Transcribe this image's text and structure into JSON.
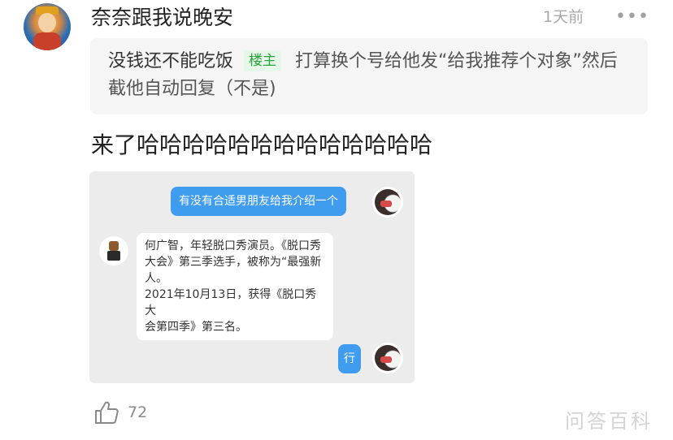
{
  "comment": {
    "username": "奈奈跟我说晚安",
    "time": "1天前",
    "more_glyph": "•••",
    "quote": {
      "author": "没钱还不能吃饭",
      "badge": "楼主",
      "text": "打算换个号给他发“给我推荐个对象”然后截他自动回复（不是)"
    },
    "reply_text": "来了哈哈哈哈哈哈哈哈哈哈哈哈哈",
    "screenshot": {
      "messages": [
        {
          "sender": "user",
          "text": "有没有合适男朋友给我介绍一个"
        },
        {
          "sender": "bot",
          "lines": [
            "何广智，年轻脱口秀演员。《脱口秀",
            "大会》第三季选手，被称为“最强新",
            "人。",
            "2021年10月13日，获得《脱口秀大",
            "会第四季》第三名。"
          ]
        },
        {
          "sender": "user",
          "text": "行"
        }
      ]
    },
    "likes": "72"
  },
  "watermark": "问答百科",
  "colors": {
    "accent_blue": "#3f9cef",
    "badge_green": "#27a53a",
    "badge_bg": "#e6f6e8"
  },
  "icons": {
    "avatar": "monkey-king-avatar",
    "more": "more-dots-icon",
    "like": "thumbs-up-icon"
  }
}
